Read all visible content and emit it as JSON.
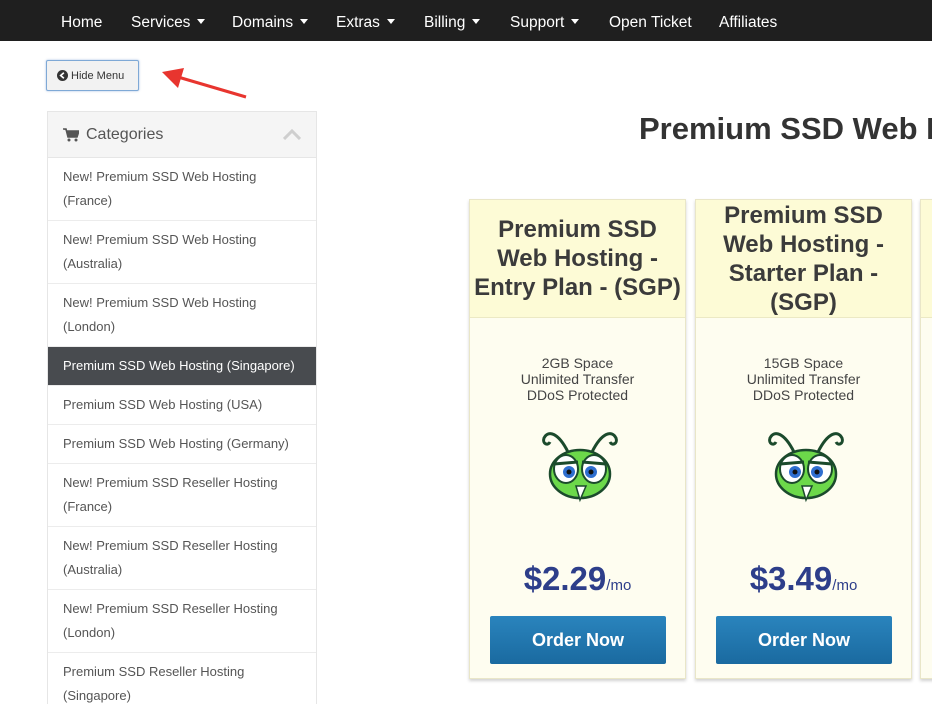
{
  "nav": {
    "items": [
      {
        "label": "Home",
        "dropdown": false
      },
      {
        "label": "Services",
        "dropdown": true
      },
      {
        "label": "Domains",
        "dropdown": true
      },
      {
        "label": "Extras",
        "dropdown": true
      },
      {
        "label": "Billing",
        "dropdown": true
      },
      {
        "label": "Support",
        "dropdown": true
      },
      {
        "label": "Open Ticket",
        "dropdown": false
      },
      {
        "label": "Affiliates",
        "dropdown": false
      }
    ]
  },
  "hide_menu": {
    "label": "Hide Menu",
    "icon": "arrow-circle-left-icon"
  },
  "sidebar": {
    "title": "Categories",
    "icon": "cart-icon",
    "items": [
      {
        "label": "New! Premium SSD Web Hosting (France)",
        "active": false
      },
      {
        "label": "New! Premium SSD Web Hosting (Australia)",
        "active": false
      },
      {
        "label": "New! Premium SSD Web Hosting (London)",
        "active": false
      },
      {
        "label": "Premium SSD Web Hosting (Singapore)",
        "active": true
      },
      {
        "label": "Premium SSD Web Hosting (USA)",
        "active": false
      },
      {
        "label": "Premium SSD Web Hosting (Germany)",
        "active": false
      },
      {
        "label": "New! Premium SSD Reseller Hosting (France)",
        "active": false
      },
      {
        "label": "New! Premium SSD Reseller Hosting (Australia)",
        "active": false
      },
      {
        "label": "New! Premium SSD Reseller Hosting (London)",
        "active": false
      },
      {
        "label": "Premium SSD Reseller Hosting (Singapore)",
        "active": false
      }
    ]
  },
  "main": {
    "title": "Premium SSD Web H",
    "plans": [
      {
        "name": "Premium SSD Web Hosting - Entry Plan - (SGP)",
        "features": [
          "2GB Space",
          "Unlimited Transfer",
          "DDoS Protected"
        ],
        "price": "$2.29",
        "period": "/mo",
        "button": "Order Now"
      },
      {
        "name": "Premium SSD Web Hosting - Starter Plan - (SGP)",
        "features": [
          "15GB Space",
          "Unlimited Transfer",
          "DDoS Protected"
        ],
        "price": "$3.49",
        "period": "/mo",
        "button": "Order Now"
      }
    ]
  },
  "colors": {
    "nav_bg": "#1f1f1f",
    "active_item_bg": "#484b4f",
    "price": "#2d3e8a",
    "order_button": "#1f74ad",
    "card_header": "#fdfbd6",
    "annotation_arrow": "#e8352f"
  }
}
